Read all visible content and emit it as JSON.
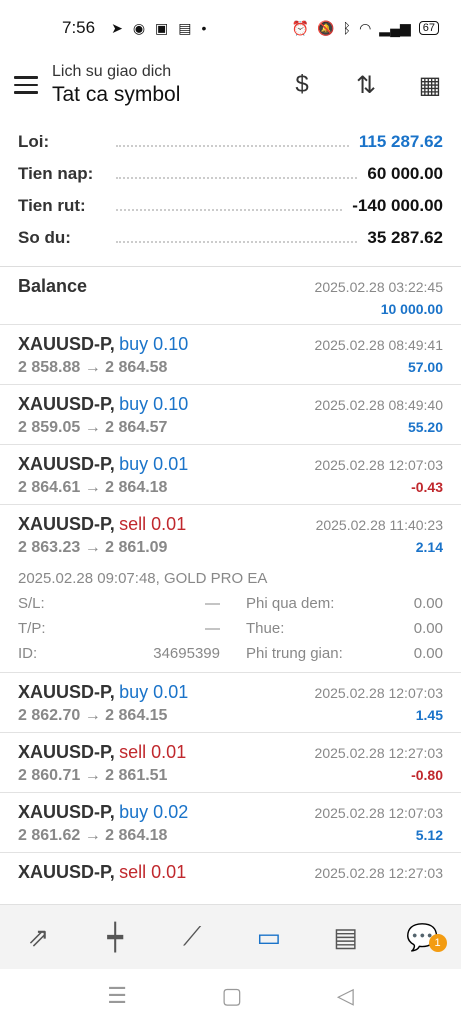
{
  "status_bar": {
    "time": "7:56",
    "battery": "67"
  },
  "header": {
    "subtitle": "Lich su giao dich",
    "title": "Tat ca symbol"
  },
  "summary": [
    {
      "label": "Loi:",
      "value": "115 287.62",
      "highlight": true
    },
    {
      "label": "Tien nap:",
      "value": "60 000.00",
      "highlight": false
    },
    {
      "label": "Tien rut:",
      "value": "-140 000.00",
      "highlight": false
    },
    {
      "label": "So du:",
      "value": "35 287.62",
      "highlight": false
    }
  ],
  "balance": {
    "label": "Balance",
    "time": "2025.02.28 03:22:45",
    "amount": "10 000.00"
  },
  "deals": [
    {
      "symbol": "XAUUSD-P,",
      "side": "buy 0.10",
      "time": "2025.02.28 08:49:41",
      "prices": "2 858.88 → 2 864.58",
      "profit": "57.00"
    },
    {
      "symbol": "XAUUSD-P,",
      "side": "buy 0.10",
      "time": "2025.02.28 08:49:40",
      "prices": "2 859.05 → 2 864.57",
      "profit": "55.20"
    },
    {
      "symbol": "XAUUSD-P,",
      "side": "buy 0.01",
      "time": "2025.02.28 12:07:03",
      "prices": "2 864.61 → 2 864.18",
      "profit": "-0.43"
    },
    {
      "symbol": "XAUUSD-P,",
      "side": "sell 0.01",
      "time": "2025.02.28 11:40:23",
      "prices": "2 863.23 → 2 861.09",
      "profit": "2.14"
    },
    {
      "symbol": "XAUUSD-P,",
      "side": "buy 0.01",
      "time": "2025.02.28 12:07:03",
      "prices": "2 862.70 → 2 864.15",
      "profit": "1.45"
    },
    {
      "symbol": "XAUUSD-P,",
      "side": "sell 0.01",
      "time": "2025.02.28 12:27:03",
      "prices": "2 860.71 → 2 861.51",
      "profit": "-0.80"
    },
    {
      "symbol": "XAUUSD-P,",
      "side": "buy 0.02",
      "time": "2025.02.28 12:07:03",
      "prices": "2 861.62 → 2 864.18",
      "profit": "5.12"
    },
    {
      "symbol": "XAUUSD-P,",
      "side": "sell 0.01",
      "time": "2025.02.28 12:27:03",
      "prices": "",
      "profit": ""
    }
  ],
  "expanded": {
    "info": "2025.02.28 09:07:48, GOLD PRO EA",
    "sl_label": "S/L:",
    "sl_value": "—",
    "tp_label": "T/P:",
    "tp_value": "—",
    "id_label": "ID:",
    "id_value": "34695399",
    "swap_label": "Phi qua dem:",
    "swap_value": "0.00",
    "tax_label": "Thue:",
    "tax_value": "0.00",
    "commission_label": "Phi trung gian:",
    "commission_value": "0.00"
  },
  "nav": {
    "chat_badge": "1"
  },
  "colors": {
    "accent": "#1a73c9",
    "loss": "#c0282d",
    "muted": "#888888"
  }
}
